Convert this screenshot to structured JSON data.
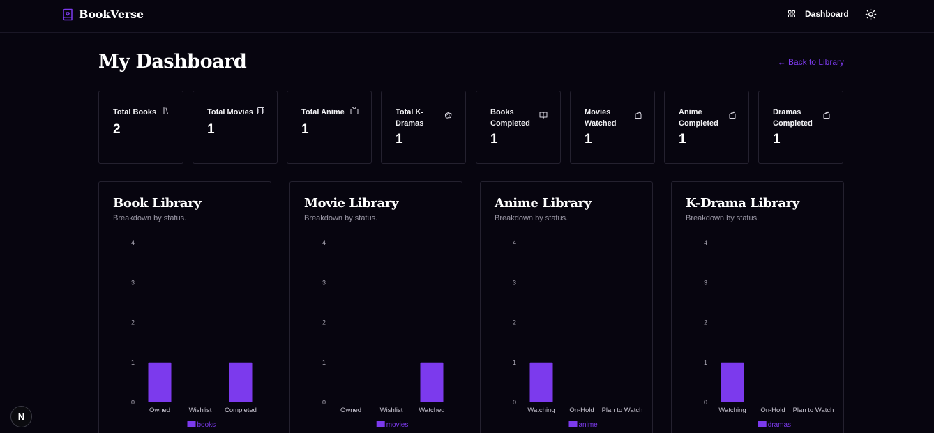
{
  "app": {
    "brand": "BookVerse"
  },
  "nav": {
    "dashboard_label": "Dashboard"
  },
  "page": {
    "title": "My Dashboard",
    "back_link": "← Back to Library"
  },
  "stats": [
    {
      "label": "Total Books",
      "value": "2",
      "icon": "library-icon"
    },
    {
      "label": "Total Movies",
      "value": "1",
      "icon": "film-icon"
    },
    {
      "label": "Total Anime",
      "value": "1",
      "icon": "tv-icon"
    },
    {
      "label": "Total K-Dramas",
      "value": "1",
      "icon": "drama-masks-icon"
    },
    {
      "label": "Books Completed",
      "value": "1",
      "icon": "book-open-icon"
    },
    {
      "label": "Movies Watched",
      "value": "1",
      "icon": "clapperboard-icon"
    },
    {
      "label": "Anime Completed",
      "value": "1",
      "icon": "clapperboard-icon"
    },
    {
      "label": "Dramas Completed",
      "value": "1",
      "icon": "clapperboard-icon"
    }
  ],
  "colors": {
    "accent": "#7c3aed",
    "background": "#07050f",
    "border": "#24212f"
  },
  "chart_data": [
    {
      "type": "bar",
      "title": "Book Library",
      "subtitle": "Breakdown by status.",
      "categories": [
        "Owned",
        "Wishlist",
        "Completed"
      ],
      "series": [
        {
          "name": "books",
          "values": [
            1,
            0,
            1
          ]
        }
      ],
      "ylim": [
        0,
        4
      ],
      "yticks": [
        0,
        1,
        2,
        3,
        4
      ],
      "legend": "bottom",
      "grid": false
    },
    {
      "type": "bar",
      "title": "Movie Library",
      "subtitle": "Breakdown by status.",
      "categories": [
        "Owned",
        "Wishlist",
        "Watched"
      ],
      "series": [
        {
          "name": "movies",
          "values": [
            0,
            0,
            1
          ]
        }
      ],
      "ylim": [
        0,
        4
      ],
      "yticks": [
        0,
        1,
        2,
        3,
        4
      ],
      "legend": "bottom",
      "grid": false
    },
    {
      "type": "bar",
      "title": "Anime Library",
      "subtitle": "Breakdown by status.",
      "categories": [
        "Watching",
        "On-Hold",
        "Plan to Watch"
      ],
      "series": [
        {
          "name": "anime",
          "values": [
            1,
            0,
            0
          ]
        }
      ],
      "ylim": [
        0,
        4
      ],
      "yticks": [
        0,
        1,
        2,
        3,
        4
      ],
      "legend": "bottom",
      "grid": false
    },
    {
      "type": "bar",
      "title": "K-Drama Library",
      "subtitle": "Breakdown by status.",
      "categories": [
        "Watching",
        "On-Hold",
        "Plan to Watch"
      ],
      "series": [
        {
          "name": "dramas",
          "values": [
            1,
            0,
            0
          ]
        }
      ],
      "ylim": [
        0,
        4
      ],
      "yticks": [
        0,
        1,
        2,
        3,
        4
      ],
      "legend": "bottom",
      "grid": false
    }
  ],
  "dev_badge": {
    "label": "N"
  }
}
